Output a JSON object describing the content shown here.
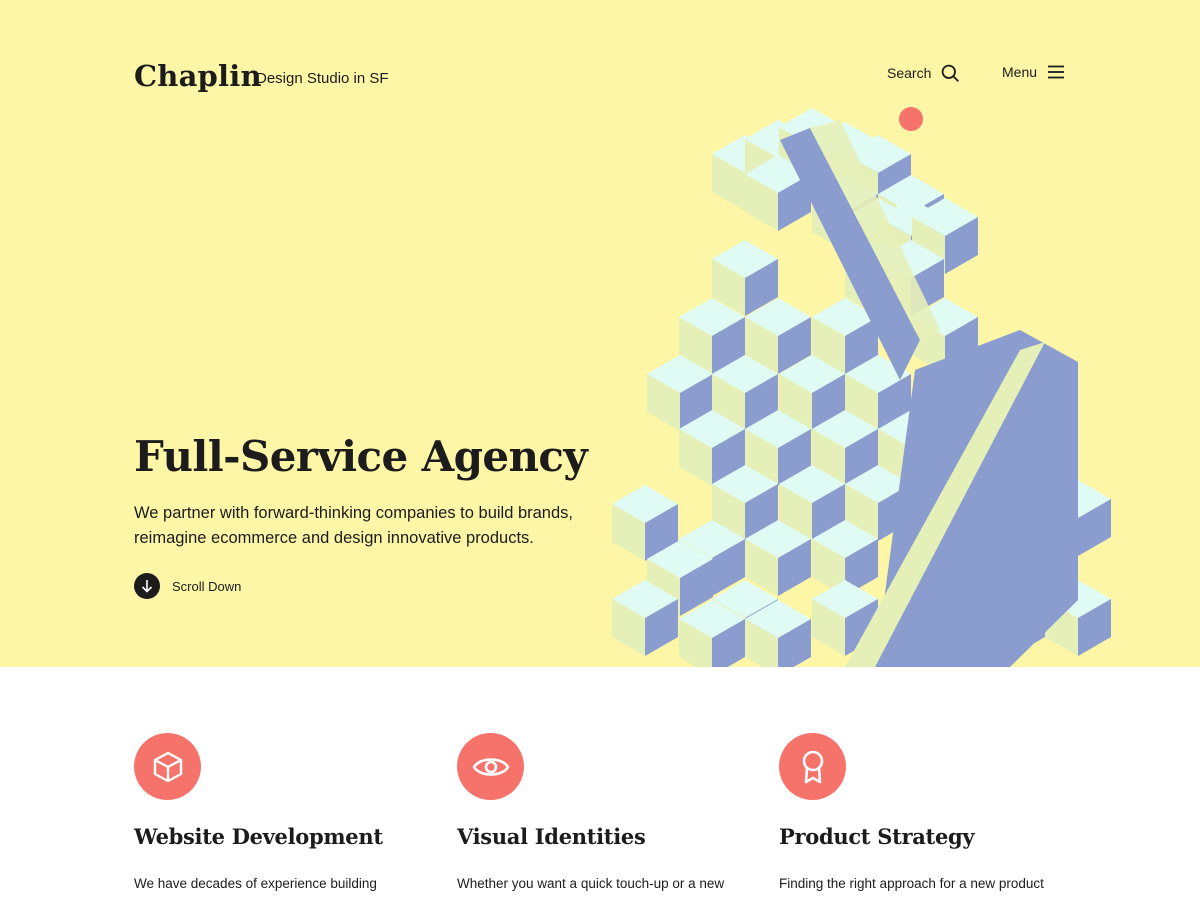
{
  "header": {
    "brand": "Chaplin",
    "tagline": "Design Studio in SF",
    "search_label": "Search",
    "menu_label": "Menu"
  },
  "hero": {
    "title": "Full-Service Agency",
    "description": "We partner with forward-thinking companies to build brands, reimagine ecommerce and design innovative products.",
    "scroll_label": "Scroll Down"
  },
  "services": [
    {
      "icon": "cube-icon",
      "title": "Website Development",
      "text": "We have decades of experience building"
    },
    {
      "icon": "eye-icon",
      "title": "Visual Identities",
      "text": "Whether you want a quick touch-up or a new"
    },
    {
      "icon": "award-icon",
      "title": "Product Strategy",
      "text": "Finding the right approach for a new product"
    }
  ],
  "colors": {
    "hero_background": "#fef6a7",
    "accent": "#f6736b",
    "text": "#1c1c1c",
    "cube_top": "#dffbf3",
    "cube_left": "#e5f0b8",
    "cube_right": "#8b9ccf"
  }
}
